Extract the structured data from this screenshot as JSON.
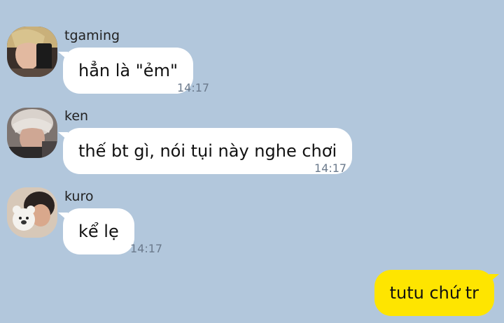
{
  "messages": [
    {
      "sender": "tgaming",
      "text": "hẳn là \"ẻm\"",
      "time": "14:17",
      "avatar_icon": "user-avatar-icon"
    },
    {
      "sender": "ken",
      "text": "thế bt gì, nói tụi này nghe chơi",
      "time": "14:17",
      "avatar_icon": "user-avatar-icon"
    },
    {
      "sender": "kuro",
      "text": "kể lẹ",
      "time": "14:17",
      "avatar_icon": "user-avatar-icon"
    }
  ],
  "outgoing": {
    "text": "tutu chứ tr"
  },
  "colors": {
    "background": "#b2c7dc",
    "incoming_bubble": "#ffffff",
    "outgoing_bubble": "#fee500",
    "timestamp": "#6b7a8c"
  }
}
